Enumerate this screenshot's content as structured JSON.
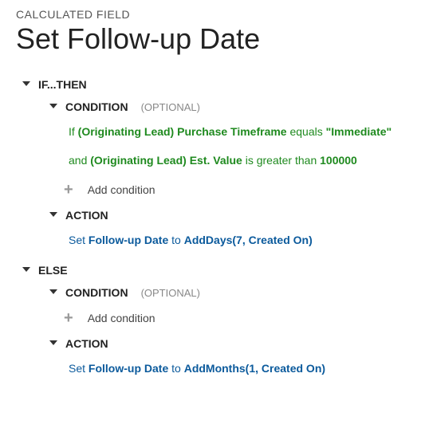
{
  "header": {
    "subtitle": "CALCULATED FIELD",
    "title": "Set Follow-up Date"
  },
  "labels": {
    "if_then": "IF...THEN",
    "else": "ELSE",
    "condition": "CONDITION",
    "action": "ACTION",
    "optional": "(OPTIONAL)",
    "add_condition": "Add condition"
  },
  "if_block": {
    "condition": {
      "line1": {
        "prefix": "If ",
        "field": "(Originating Lead) Purchase Timeframe",
        "operator": " equals ",
        "value": "\"Immediate\""
      },
      "line2": {
        "prefix": "and ",
        "field": "(Originating Lead) Est. Value",
        "operator": " is greater than ",
        "value": "100000"
      }
    },
    "action": {
      "prefix": "Set ",
      "field": "Follow-up Date",
      "mid": " to ",
      "func": "AddDays(7, Created On)"
    }
  },
  "else_block": {
    "action": {
      "prefix": "Set ",
      "field": "Follow-up Date",
      "mid": " to ",
      "func": "AddMonths(1, Created On)"
    }
  }
}
